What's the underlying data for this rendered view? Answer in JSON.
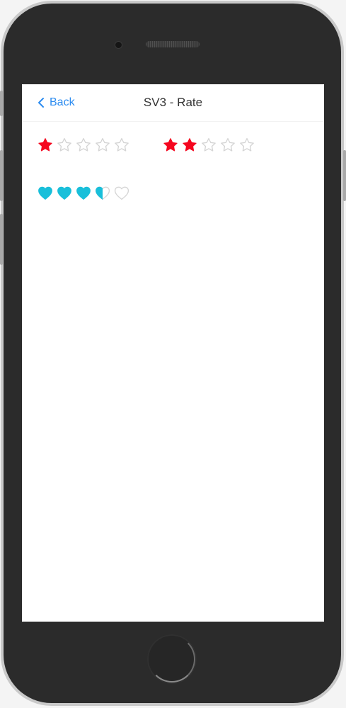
{
  "header": {
    "back_label": "Back",
    "title": "SV3 - Rate"
  },
  "ratings": [
    {
      "icon": "star-icon",
      "value": 1,
      "max": 5,
      "color": "#f5061f"
    },
    {
      "icon": "star-icon",
      "value": 2,
      "max": 5,
      "color": "#f5061f"
    },
    {
      "icon": "heart-icon",
      "value": 3.5,
      "max": 5,
      "color": "#19bfda"
    }
  ],
  "colors": {
    "empty_outline": "#d4d4d4",
    "link": "#2d8cf0"
  }
}
